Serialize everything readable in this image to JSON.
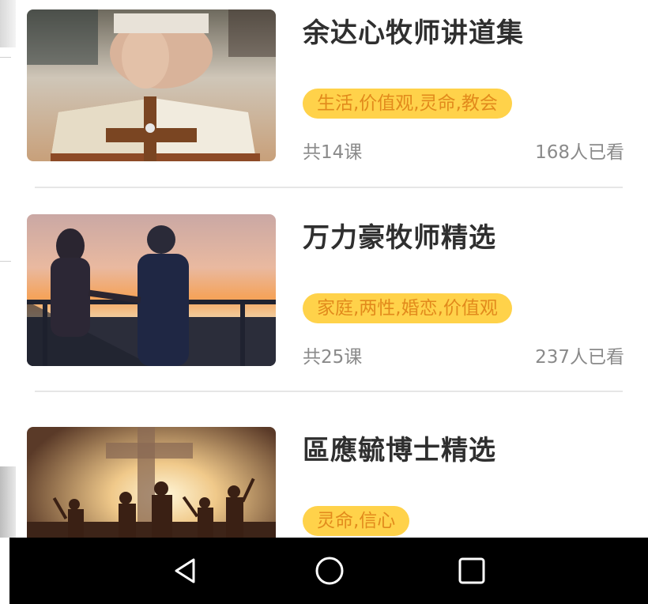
{
  "courses": [
    {
      "title": "余达心牧师讲道集",
      "tags": "生活,价值观,灵命,教会",
      "lessons": "共14课",
      "views": "168人已看",
      "image": "hands-praying-over-bible-with-cross"
    },
    {
      "title": "万力豪牧师精选",
      "tags": "家庭,两性,婚恋,价值观",
      "lessons": "共25课",
      "views": "237人已看",
      "image": "couple-holding-hands-at-sunset"
    },
    {
      "title": "區應毓博士精选",
      "tags": "灵命,信心",
      "image": "people-raising-hands-before-cross"
    }
  ],
  "colors": {
    "tag_bg": "#ffd24a",
    "tag_text": "#e28a1c",
    "title": "#2f2f2f",
    "meta": "#8a8a8a",
    "navbar": "#000000"
  },
  "navbar": {
    "back_icon": "triangle-back-icon",
    "home_icon": "circle-home-icon",
    "recents_icon": "square-recents-icon"
  }
}
